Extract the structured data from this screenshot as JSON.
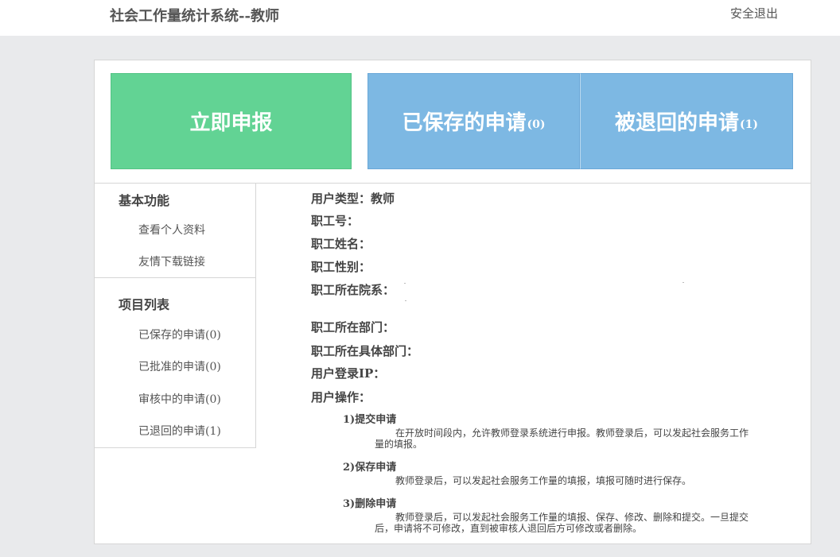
{
  "header": {
    "title": "社会工作量统计系统--教师",
    "logout_label": "安全退出"
  },
  "tiles": {
    "report_now": "立即申报",
    "saved_label": "已保存的申请",
    "saved_count": "(0)",
    "returned_label": "被退回的申请",
    "returned_count": "(1)"
  },
  "sidebar": {
    "basic_heading": "基本功能",
    "basic_items": [
      "查看个人资料",
      "友情下载链接"
    ],
    "project_heading": "项目列表",
    "project_items": [
      {
        "label": "已保存的申请",
        "count": "(0)"
      },
      {
        "label": "已批准的申请",
        "count": "(0)"
      },
      {
        "label": "审核中的申请",
        "count": "(0)"
      },
      {
        "label": "已退回的申请",
        "count": "(1)"
      }
    ]
  },
  "info": {
    "user_type": "用户类型：教师",
    "staff_id": "职工号：",
    "staff_name": "职工姓名：",
    "staff_gender": "职工性别：",
    "staff_college": "职工所在院系：",
    "staff_dept": "职工所在部门：",
    "staff_subdept": "职工所在具体部门：",
    "login_ip": "用户登录IP：",
    "user_ops": "用户操作："
  },
  "operations": [
    {
      "title": "1)提交申请",
      "desc": "在开放时间段内，允许教师登录系统进行申报。教师登录后，可以发起社会服务工作量的填报。"
    },
    {
      "title": "2)保存申请",
      "desc": "教师登录后，可以发起社会服务工作量的填报，填报可随时进行保存。"
    },
    {
      "title": "3)删除申请",
      "desc": "教师登录后，可以发起社会服务工作量的填报、保存、修改、删除和提交。一旦提交后，申请将不可修改，直到被审核人退回后方可修改或者删除。"
    }
  ]
}
